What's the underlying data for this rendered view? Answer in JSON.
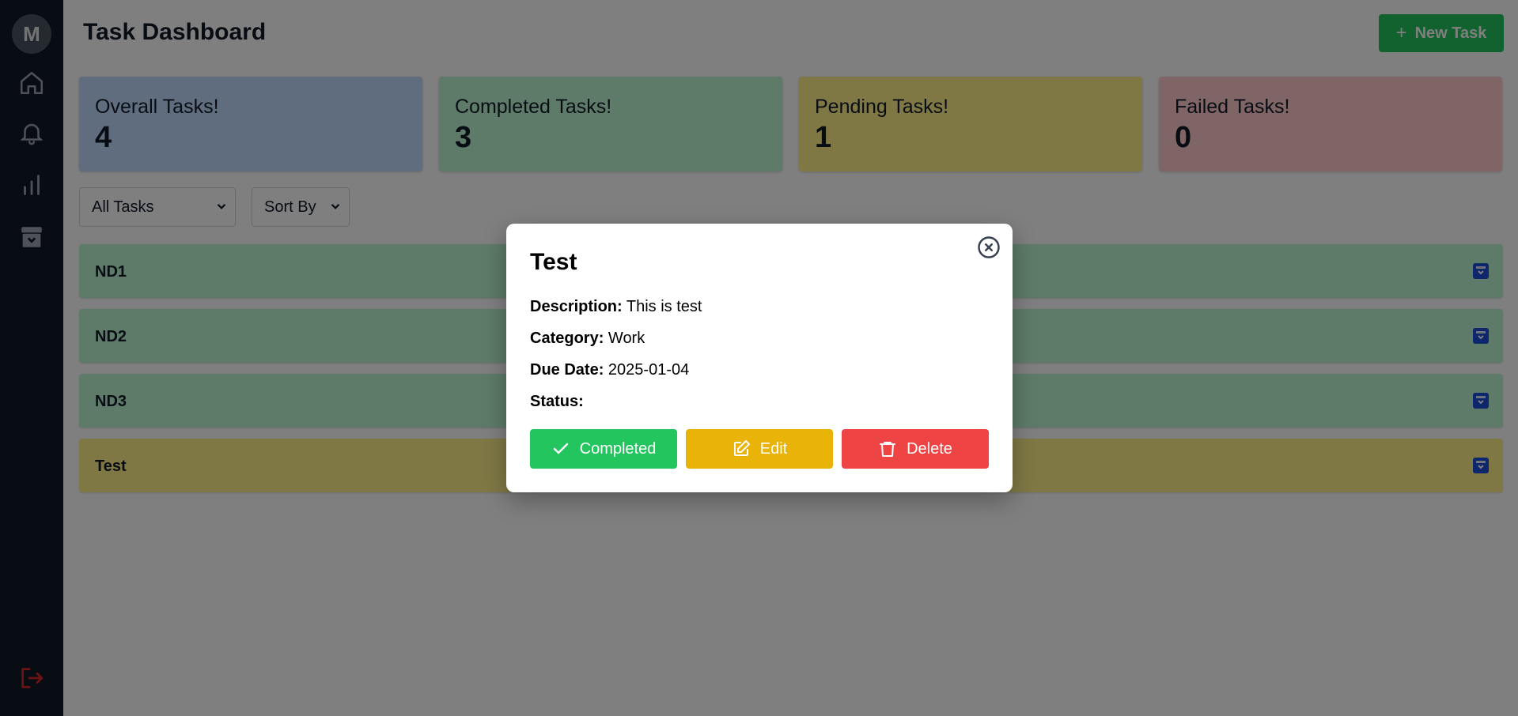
{
  "sidebar": {
    "avatar_initial": "M",
    "items": [
      {
        "icon": "home-icon"
      },
      {
        "icon": "bell-icon"
      },
      {
        "icon": "bar-chart-icon"
      },
      {
        "icon": "archive-icon"
      }
    ],
    "logout_icon": "logout-icon"
  },
  "header": {
    "title": "Task Dashboard",
    "new_task_label": "New Task"
  },
  "stats": [
    {
      "label": "Overall Tasks!",
      "value": "4",
      "color": "#bfdbfe"
    },
    {
      "label": "Completed Tasks!",
      "value": "3",
      "color": "#bbf7d0"
    },
    {
      "label": "Pending Tasks!",
      "value": "1",
      "color": "#fef08a"
    },
    {
      "label": "Failed Tasks!",
      "value": "0",
      "color": "#fecaca"
    }
  ],
  "filters": {
    "task_filter": "All Tasks",
    "sort": "Sort By"
  },
  "tasks": [
    {
      "name": "ND1",
      "color": "#bbf7d0"
    },
    {
      "name": "ND2",
      "color": "#bbf7d0"
    },
    {
      "name": "ND3",
      "color": "#bbf7d0"
    },
    {
      "name": "Test",
      "color": "#fef08a"
    }
  ],
  "modal": {
    "title": "Test",
    "description_label": "Description:",
    "description": "This is test",
    "category_label": "Category:",
    "category": "Work",
    "due_label": "Due Date:",
    "due": "2025-01-04",
    "status_label": "Status:",
    "status": "",
    "completed_label": "Completed",
    "edit_label": "Edit",
    "delete_label": "Delete"
  },
  "colors": {
    "sidebar": "#111827",
    "primary_green": "#22c55e",
    "edit_yellow": "#eab308",
    "delete_red": "#ef4444",
    "archive_blue": "#1d4ed8",
    "logout_red": "#dc2626"
  }
}
